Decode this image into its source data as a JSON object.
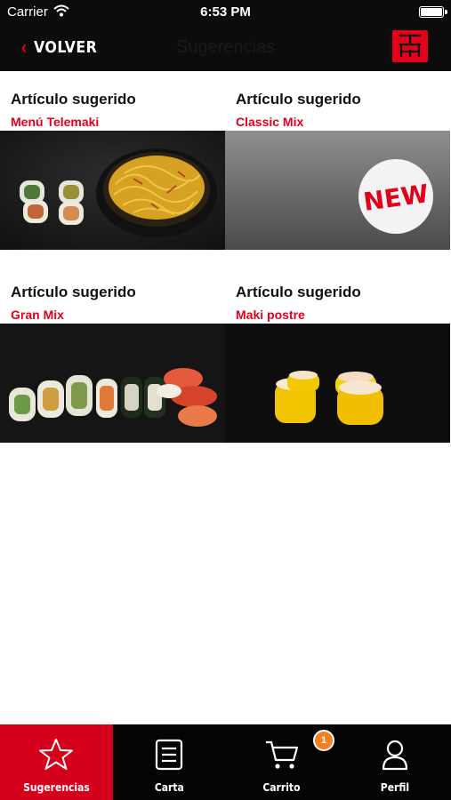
{
  "status_bar": {
    "carrier": "Carrier",
    "time": "6:53 PM"
  },
  "nav": {
    "back_label": "VOLVER",
    "title": "Sugerencias",
    "logo_icon": "telemaki-logo-icon"
  },
  "suggestions": [
    {
      "header": "Artículo sugerido",
      "name": "Menú Telemaki",
      "image": "maki-rolls-and-noodles"
    },
    {
      "header": "Artículo sugerido",
      "name": "Classic Mix",
      "image": "new-badge-placeholder",
      "badge": "NEW"
    },
    {
      "header": "Artículo sugerido",
      "name": "Gran Mix",
      "image": "sushi-assortment"
    },
    {
      "header": "Artículo sugerido",
      "name": "Maki postre",
      "image": "mango-dessert-maki"
    }
  ],
  "tabs": [
    {
      "label": "Sugerencias",
      "icon": "star-icon",
      "active": true
    },
    {
      "label": "Carta",
      "icon": "menu-list-icon",
      "active": false
    },
    {
      "label": "Carrito",
      "icon": "cart-icon",
      "active": false,
      "badge": "1"
    },
    {
      "label": "Perfil",
      "icon": "user-icon",
      "active": false
    }
  ],
  "colors": {
    "accent": "#e2001a",
    "topbar": "#0c0c0c",
    "tabbar": "#050505",
    "badge": "#f2821f"
  }
}
